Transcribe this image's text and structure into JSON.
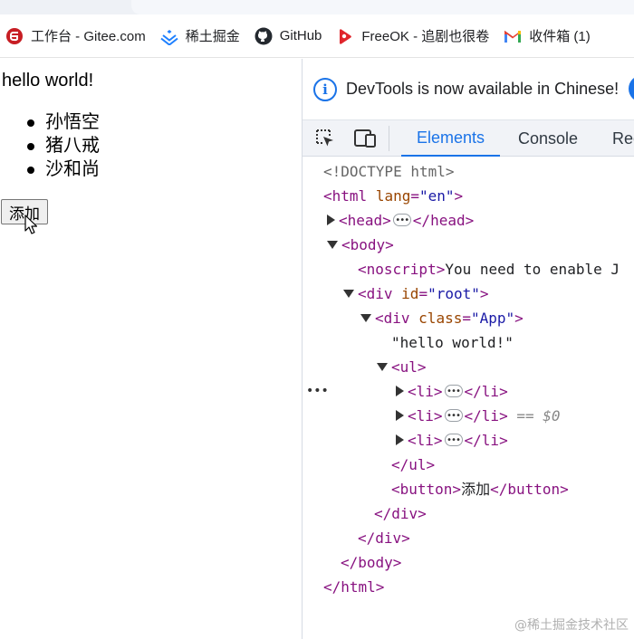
{
  "bookmarks": [
    {
      "label": "工作台 - Gitee.com",
      "icon": "gitee-icon"
    },
    {
      "label": "稀土掘金",
      "icon": "juejin-icon"
    },
    {
      "label": "GitHub",
      "icon": "github-icon"
    },
    {
      "label": "FreeOK - 追剧也很卷",
      "icon": "freeok-icon"
    },
    {
      "label": "收件箱 (1)",
      "icon": "gmail-icon"
    }
  ],
  "page": {
    "hello": "hello world!",
    "items": [
      "孙悟空",
      "猪八戒",
      "沙和尚"
    ],
    "add_button": "添加"
  },
  "devtools": {
    "infobar_text": "DevTools is now available in Chinese!",
    "tabs": [
      "Elements",
      "Console",
      "Rec"
    ],
    "active_tab": "Elements",
    "dom": {
      "doctype": "<!DOCTYPE html>",
      "html_open": "<html",
      "lang_attr": "lang",
      "lang_val": "\"en\"",
      "head_open": "<head>",
      "head_close": "</head>",
      "body_open": "<body>",
      "noscript_open": "<noscript>",
      "noscript_text": "You need to enable J",
      "div_open": "<div",
      "id_attr": "id",
      "id_val": "\"root\"",
      "class_attr": "class",
      "class_val": "\"App\"",
      "hello_text": "\"hello world!\"",
      "ul_open": "<ul>",
      "li_open": "<li>",
      "li_close": "</li>",
      "selected_marker": "== $0",
      "ul_close": "</ul>",
      "button_open": "<button>",
      "button_text": "添加",
      "button_close": "</button>",
      "div_close": "</div>",
      "body_close": "</body>",
      "html_close": "</html>",
      "gt": ">"
    }
  },
  "watermark": "@稀土掘金技术社区",
  "colors": {
    "accent": "#1a73e8",
    "tag": "#881280",
    "attr_name": "#994500",
    "attr_value": "#1a1aa6"
  }
}
